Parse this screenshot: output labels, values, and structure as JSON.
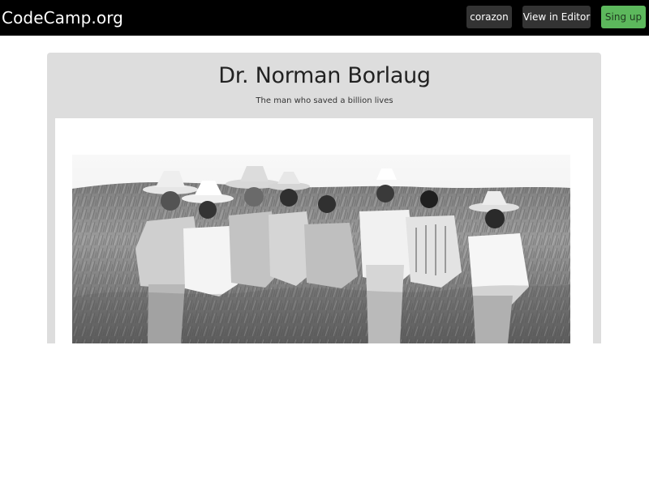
{
  "navbar": {
    "brand": "CodeCamp.org",
    "user_button": "corazon",
    "editor_button": "View in Editor",
    "signup_button": "Sing up",
    "colors": {
      "background": "#000000",
      "button_dark": "#333333",
      "button_green": "#5cb85c"
    }
  },
  "tribute": {
    "title": "Dr. Norman Borlaug",
    "subtitle": "The man who saved a billion lives",
    "image": {
      "icon": "black-and-white-photo",
      "colors": {
        "sky": "#f7f7f7",
        "field": "#8a8a8a",
        "shirts": "#e8e8e8"
      }
    },
    "colors": {
      "card_background": "#dddddd",
      "image_background": "#ffffff"
    }
  }
}
